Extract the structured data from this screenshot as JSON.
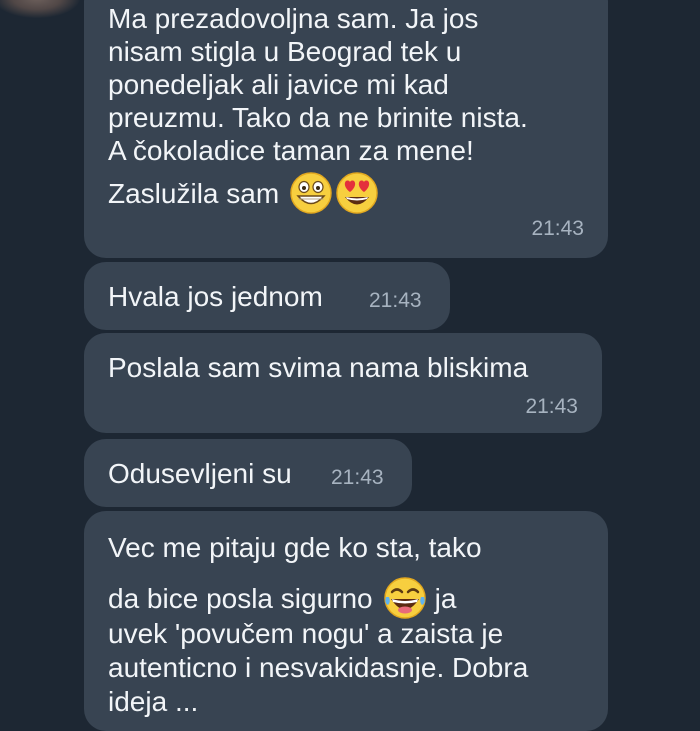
{
  "chat": {
    "messages": [
      {
        "lines": [
          "Ma prezadovoljna sam. Ja jos",
          "nisam stigla u Beograd tek u",
          "ponedeljak ali javice mi kad",
          "preuzmu. Tako da ne brinite nista.",
          "A čokoladice taman za mene!"
        ],
        "last_line": "Zaslužila sam",
        "emojis": [
          "grinning-face-icon",
          "heart-eyes-face-icon"
        ],
        "time": "21:43"
      },
      {
        "text": "Hvala jos jednom",
        "time": "21:43"
      },
      {
        "text": "Poslala sam svima nama bliskima",
        "time": "21:43"
      },
      {
        "text": "Odusevljeni su",
        "time": "21:43"
      },
      {
        "line1": "Vec me pitaju gde ko sta, tako",
        "line2_before": "da bice posla sigurno",
        "line2_after": "ja",
        "line3": "uvek 'povučem nogu' a zaista je",
        "line4": "autenticno i nesvakidasnje. Dobra",
        "line5": "ideja ...",
        "emoji": "laughing-face-icon"
      }
    ]
  },
  "colors": {
    "background": "#1d2733",
    "bubble": "#384452",
    "text": "#f2f5f8",
    "time": "#a7b3c0"
  }
}
